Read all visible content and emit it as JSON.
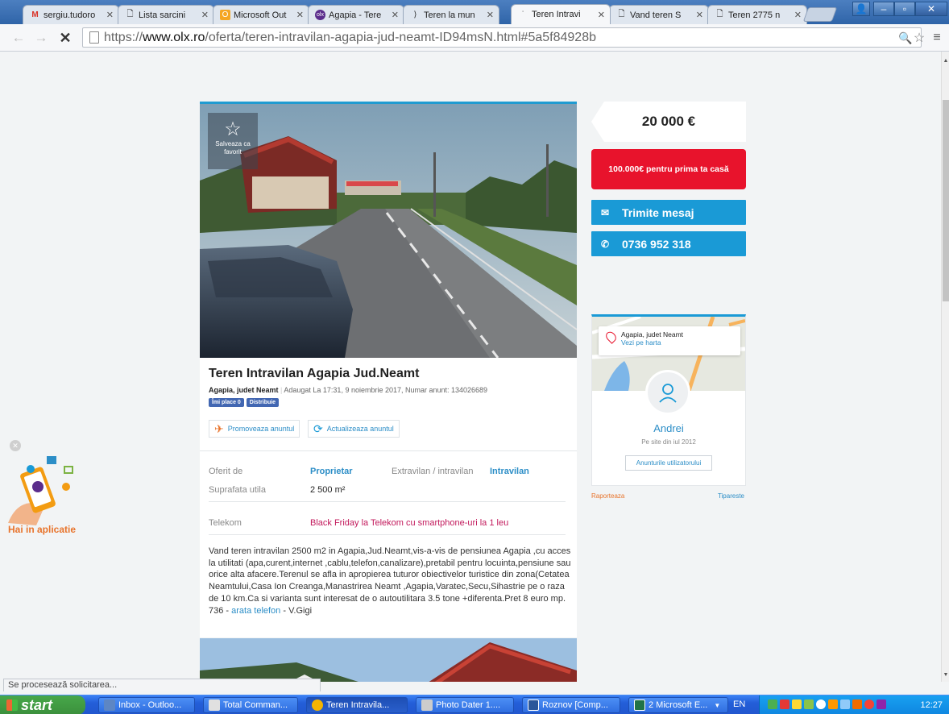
{
  "browser": {
    "tabs": [
      {
        "label": "sergiu.tudoro",
        "icon": "gmail-icon",
        "active": false
      },
      {
        "label": "Lista sarcini",
        "icon": "page-icon",
        "active": false
      },
      {
        "label": "Microsoft Out",
        "icon": "outlook-icon",
        "active": false
      },
      {
        "label": "Agapia - Tere",
        "icon": "olx-icon",
        "active": false
      },
      {
        "label": "Teren la mun",
        "icon": "page-icon",
        "active": false
      },
      {
        "label": "Teren Intravi",
        "icon": "page-icon",
        "active": true
      },
      {
        "label": "Vand teren S",
        "icon": "page-icon",
        "active": false
      },
      {
        "label": "Teren 2775 n",
        "icon": "page-icon",
        "active": false
      }
    ],
    "url_prefix": "https://",
    "url_domain": "www.olx.ro",
    "url_path": "/oferta/teren-intravilan-agapia-jud-neamt-ID94msN.html#5a5f84928b",
    "status_text": "Se procesează solicitarea..."
  },
  "ad": {
    "save_favorite": "Salveaza ca favorit",
    "title": "Teren Intravilan Agapia Jud.Neamt",
    "location": "Agapia, judet Neamt",
    "added": "Adaugat La 17:31, 9 noiembrie 2017, Numar anunt: 134026689",
    "like_label": "Îmi place 0",
    "share_label": "Distribuie",
    "promote_label": "Promoveaza anuntul",
    "refresh_label": "Actualizeaza anuntul",
    "params": {
      "offered_by_label": "Oferit de",
      "offered_by_value": "Proprietar",
      "type_label": "Extravilan / intravilan",
      "type_value": "Intravilan",
      "area_label": "Suprafata utila",
      "area_value": "2 500 m²",
      "telekom_label": "Telekom",
      "telekom_value": "Black Friday la Telekom cu smartphone-uri la 1 leu"
    },
    "description": "Vand teren intravilan 2500 m2 in Agapia,Jud.Neamt,vis-a-vis de pensiunea Agapia ,cu acces la utilitati (apa,curent,internet ,cablu,telefon,canalizare),pretabil pentru locuinta,pensiune sau orice alta afacere.Terenul se afla in apropierea tuturor obiectivelor turistice din zona(Cetatea Neamtului,Casa Ion Creanga,Manastrirea Neamt ,Agapia,Varatec,Secu,Sihastrie pe o raza de 10 km.Ca si varianta sunt interesat de o autoutilitara 3.5 tone +diferenta.Pret 8 euro mp.",
    "phone_prefix": "736 - ",
    "phone_link": "arata telefon",
    "phone_suffix": " - V.Gigi"
  },
  "sidebar": {
    "price": "20 000 €",
    "promo": "100.000€ pentru prima ta casă",
    "message_btn": "Trimite mesaj",
    "phone_btn": "0736 952 318",
    "map_location": "Agapia, judet Neamt",
    "map_link": "Vezi pe harta",
    "user_name": "Andrei",
    "user_since": "Pe site din iul 2012",
    "user_ads": "Anunturile utilizatorului",
    "report": "Raporteaza",
    "print": "Tipareste"
  },
  "app_widget": {
    "label": "Hai in aplicatie"
  },
  "taskbar": {
    "start": "start",
    "items": [
      {
        "label": "Inbox - Outloo..."
      },
      {
        "label": "Total Comman..."
      },
      {
        "label": "Teren Intravila..."
      },
      {
        "label": "Photo Dater 1...."
      },
      {
        "label": "Roznov [Comp..."
      },
      {
        "label": "2 Microsoft E..."
      }
    ],
    "language": "EN",
    "clock": "12:27"
  },
  "colors": {
    "olx_blue": "#1a9ad6",
    "promo_red": "#e8132c",
    "telekom_pink": "#c2185b",
    "report_orange": "#e8742c"
  }
}
